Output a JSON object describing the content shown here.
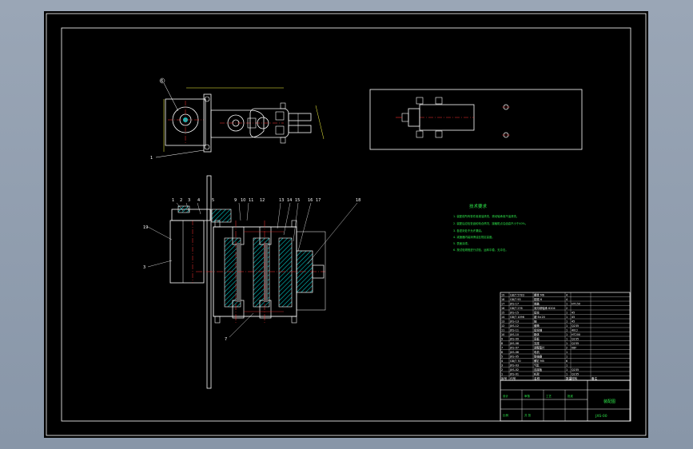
{
  "drawing": {
    "colors": {
      "background": "#000000",
      "line": "#ffffff",
      "hatch": "#00c8c8",
      "center_line": "#ff3030",
      "dimension": "#ffff40",
      "notes": "#2ee64a",
      "frame_bg": "#8e9bad"
    },
    "top_view": {
      "balloons": [
        "6",
        "1"
      ]
    },
    "front_view": {
      "balloons_top": [
        "1",
        "2",
        "3",
        "4",
        "5",
        "9",
        "10",
        "11",
        "12",
        "13",
        "14",
        "15",
        "16",
        "17",
        "18"
      ],
      "balloons_left": [
        "19",
        "3"
      ],
      "balloons_bottom": [
        "7"
      ]
    },
    "tech_notes": {
      "title": "技术要求",
      "lines": [
        "1. 装配前所有零件用煤油清洗，滚动轴承用汽油清洗。",
        "2. 装配后应检查齿轮啮合情况，接触斑点沿齿高不小于40%。",
        "3. 各密封处不允许漏油。",
        "4. 减速器内装润滑油至规定高度。",
        "5. 表面涂漆。",
        "6. 按试验规程进行试验，运转平稳，无冲击。"
      ]
    },
    "parts_list": {
      "rows": [
        [
          "19",
          "GB/T 5783",
          "螺栓 M6",
          "4",
          "",
          ""
        ],
        [
          "18",
          "GB/T 93",
          "垫圈 6",
          "4",
          "",
          ""
        ],
        [
          "17",
          "JXS-17",
          "端盖",
          "1",
          "HT150",
          ""
        ],
        [
          "16",
          "GB/T 276",
          "深沟球轴承 6204",
          "2",
          "",
          ""
        ],
        [
          "15",
          "JXS-15",
          "齿轮",
          "1",
          "45",
          ""
        ],
        [
          "14",
          "GB/T 1096",
          "键 6×20",
          "1",
          "45",
          ""
        ],
        [
          "13",
          "JXS-13",
          "轴",
          "1",
          "45",
          ""
        ],
        [
          "12",
          "JXS-12",
          "套筒",
          "1",
          "Q235",
          ""
        ],
        [
          "11",
          "JXS-11",
          "齿轮轴",
          "1",
          "40Cr",
          ""
        ],
        [
          "10",
          "JXS-10",
          "箱体",
          "1",
          "HT200",
          ""
        ],
        [
          "9",
          "JXS-09",
          "底板",
          "1",
          "Q235",
          ""
        ],
        [
          "8",
          "JXS-08",
          "支座",
          "1",
          "Q235",
          ""
        ],
        [
          "7",
          "JXS-07",
          "调整垫片",
          "2",
          "08F",
          ""
        ],
        [
          "6",
          "JXS-06",
          "电机",
          "1",
          "",
          ""
        ],
        [
          "5",
          "JXS-05",
          "联轴器",
          "1",
          "",
          ""
        ],
        [
          "4",
          "GB/T 70",
          "螺钉 M5",
          "6",
          "",
          ""
        ],
        [
          "3",
          "JXS-03",
          "气缸",
          "1",
          "",
          ""
        ],
        [
          "2",
          "JXS-02",
          "连接板",
          "1",
          "Q235",
          ""
        ],
        [
          "1",
          "JXS-01",
          "机架",
          "1",
          "Q235",
          ""
        ]
      ],
      "header": [
        "序号",
        "代号",
        "名称",
        "数量",
        "材料",
        "备注"
      ]
    },
    "title_block": {
      "drawing_name": "装配图",
      "drawing_number": "JXS-00",
      "fields": [
        "设计",
        "审核",
        "工艺",
        "批准",
        "比例",
        "共 张"
      ]
    }
  }
}
